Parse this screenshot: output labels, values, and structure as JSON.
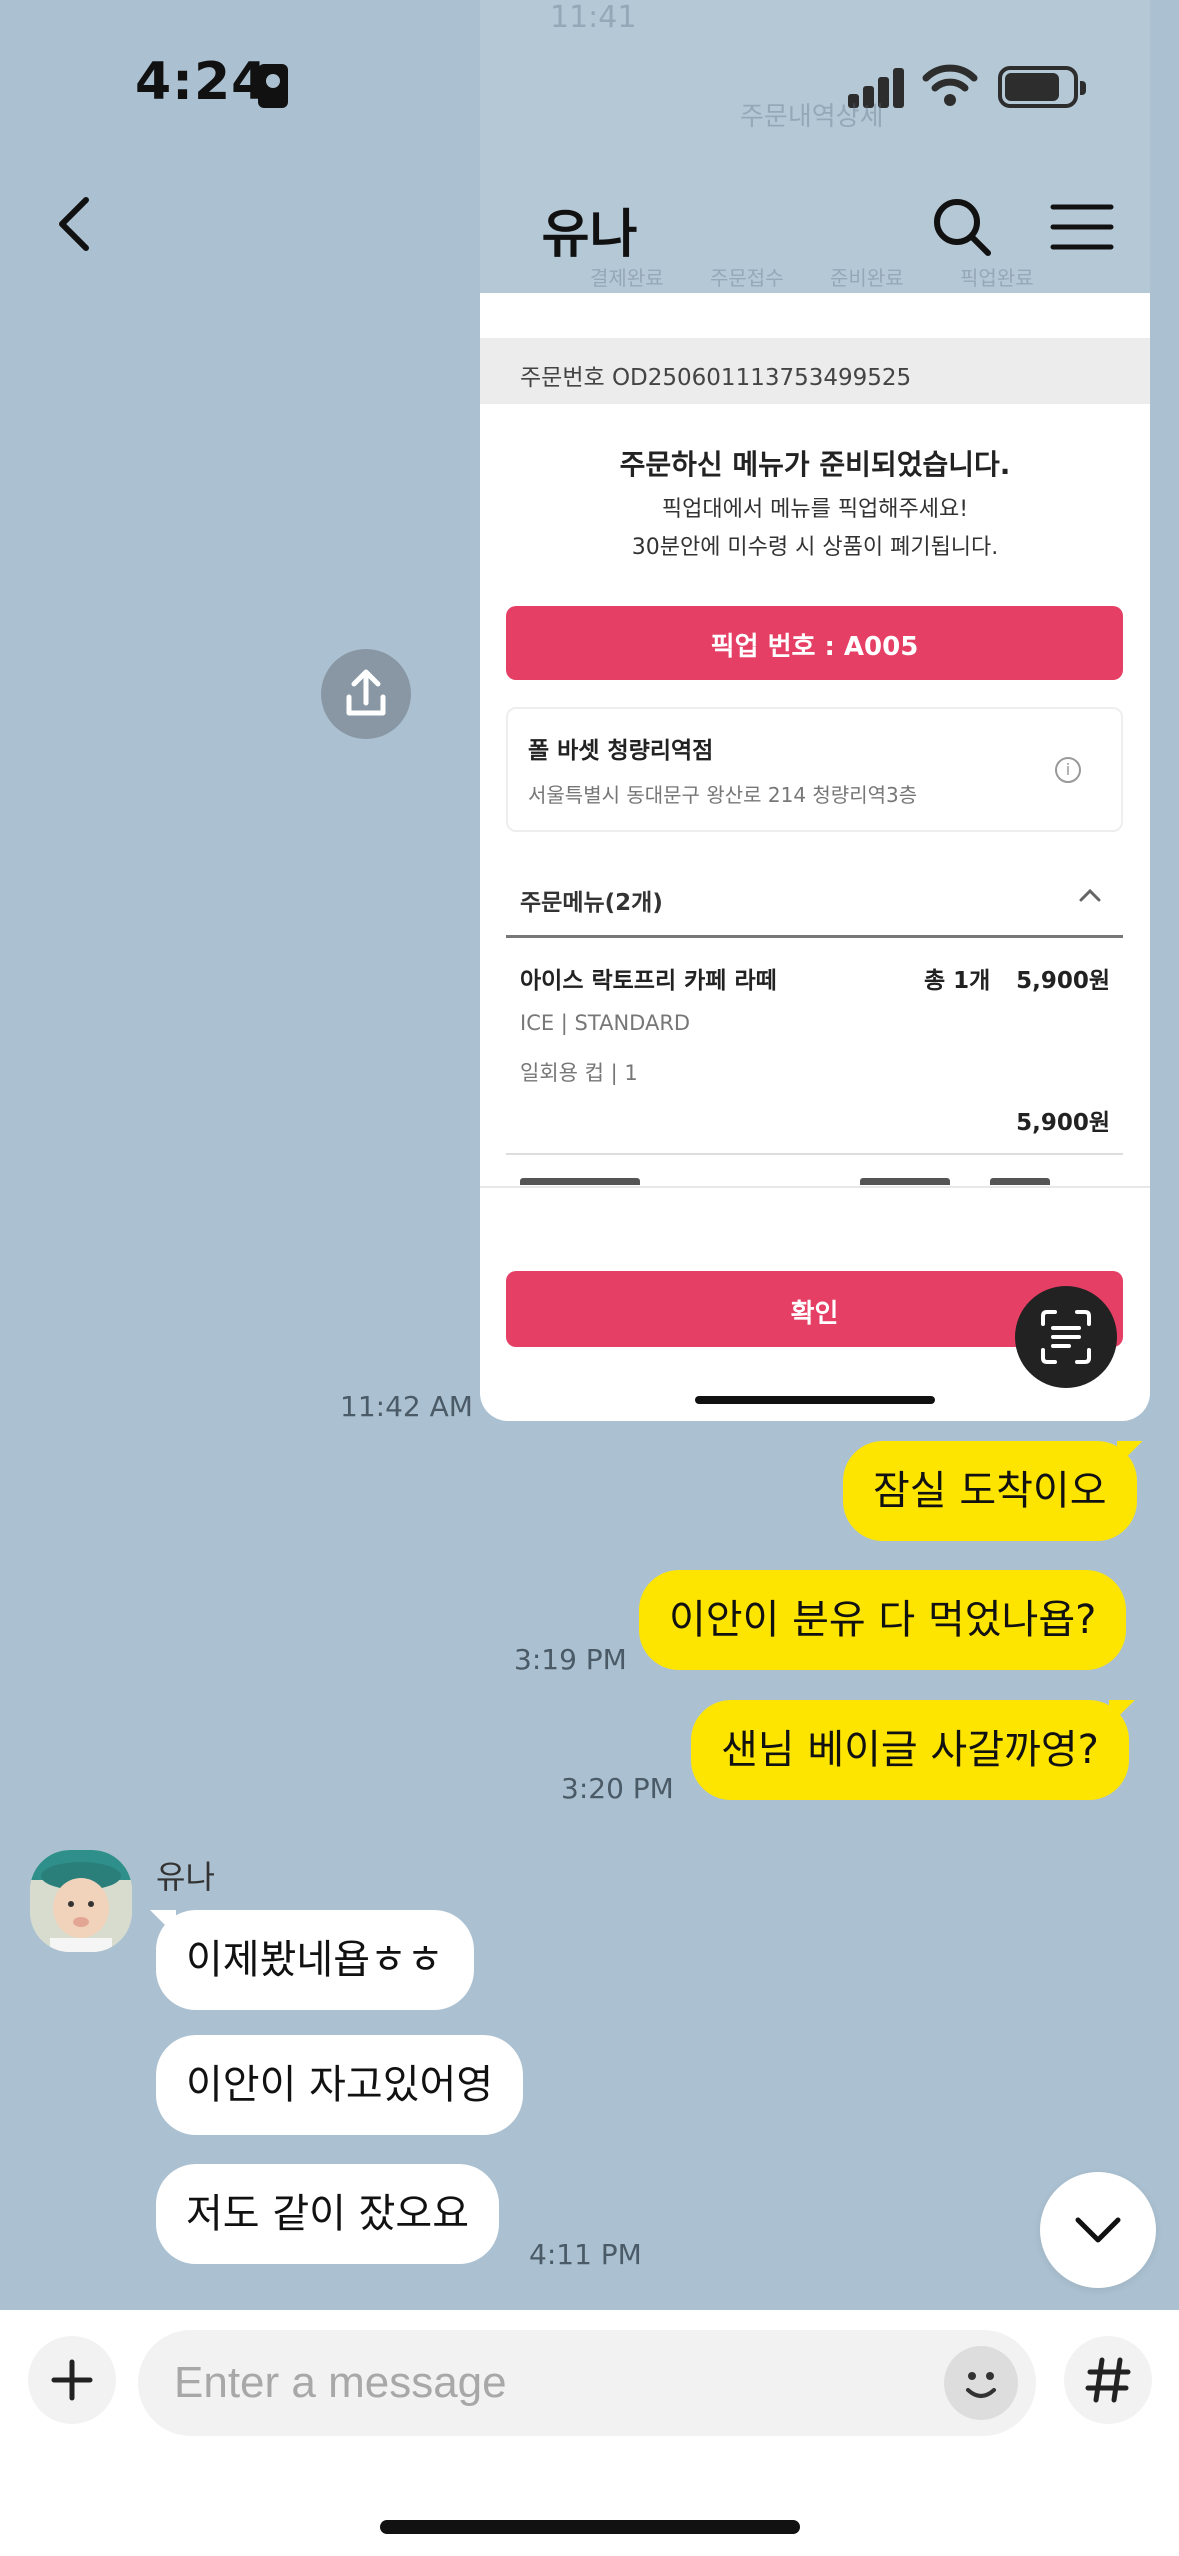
{
  "status_bar": {
    "time": "4:24"
  },
  "header": {
    "title": "유나"
  },
  "shared_image": {
    "ghost": {
      "time": "11:41",
      "title": "주문내역상세",
      "steps": [
        "결제완료",
        "주문접수",
        "준비완료",
        "픽업완료"
      ]
    },
    "order_number": "주문번호 OD250601113753499525",
    "ready_title": "주문하신 메뉴가 준비되었습니다.",
    "ready_sub1": "픽업대에서 메뉴를 픽업해주세요!",
    "ready_sub2": "30분안에 미수령 시 상품이 폐기됩니다.",
    "pickup_label": "픽업 번호 : A005",
    "store_name": "폴 바셋 청량리역점",
    "store_address": "서울특별시 동대문구 왕산로 214 청량리역3층",
    "menu_header": "주문메뉴(2개)",
    "item": {
      "name": "아이스 락토프리 카페 라떼",
      "count": "총 1개",
      "price": "5,900원",
      "option1": "ICE | STANDARD",
      "option2": "일회용 컵 | 1",
      "subtotal": "5,900원"
    },
    "confirm_label": "확인"
  },
  "messages": {
    "image_time": "11:42 AM",
    "me1": "잠실 도착이오",
    "me2": "이안이 분유 다 먹었나욥?",
    "me2_time": "3:19 PM",
    "me3": "샌님 베이글 사갈까영?",
    "me3_time": "3:20 PM",
    "sender": "유나",
    "them1": "이제봤네욥ㅎㅎ",
    "them2": "이안이 자고있어영",
    "them3": "저도 같이 잤오요",
    "them3_time": "4:11 PM"
  },
  "input": {
    "placeholder": "Enter a message"
  },
  "colors": {
    "background": "#abc1d1",
    "my_bubble": "#fee500",
    "their_bubble": "#ffffff",
    "accent_pink": "#e63f65"
  }
}
